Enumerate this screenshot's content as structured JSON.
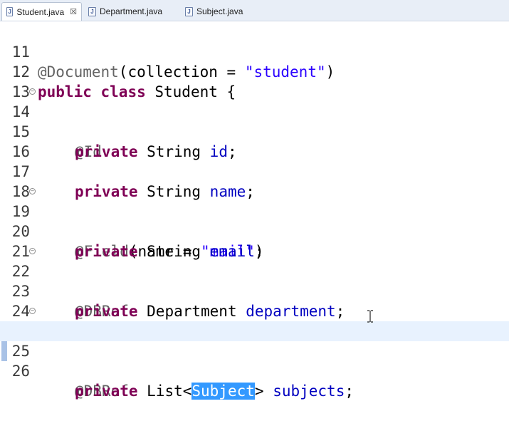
{
  "tabs": [
    {
      "label": "Student.java",
      "active": true,
      "close": "☒"
    },
    {
      "label": "Department.java",
      "active": false
    },
    {
      "label": "Subject.java",
      "active": false
    }
  ],
  "icons": {
    "java_file": "java-file-icon",
    "fold": "fold-collapse-icon",
    "cursor": "ibeam-cursor-icon"
  },
  "colors": {
    "keyword": "#7f0055",
    "string": "#2a00ff",
    "field": "#0000c0",
    "annotation": "#646464",
    "selection": "#3399ff"
  },
  "lines": [
    {
      "num": "11",
      "t": {
        "a": "@Document",
        "b": "(collection = ",
        "c": "\"student\"",
        "d": ")"
      }
    },
    {
      "num": "12",
      "t": {
        "k1": "public",
        "s1": " ",
        "k2": "class",
        "r": " Student {"
      }
    },
    {
      "num": "13"
    },
    {
      "num": "14",
      "t": {
        "a": "@Id"
      }
    },
    {
      "num": "15",
      "t": {
        "k": "private",
        "r": " String ",
        "f": "id",
        "e": ";"
      }
    },
    {
      "num": "16"
    },
    {
      "num": "17",
      "t": {
        "k": "private",
        "r": " String ",
        "f": "name",
        "e": ";"
      }
    },
    {
      "num": "18"
    },
    {
      "num": "19",
      "t": {
        "a": "@Field",
        "b": "(name = ",
        "c": "\"mail\"",
        "d": ")"
      }
    },
    {
      "num": "20",
      "t": {
        "k": "private",
        "r": " String ",
        "f": "email",
        "e": ";"
      }
    },
    {
      "num": "21"
    },
    {
      "num": "22",
      "t": {
        "a": "@DBRef"
      }
    },
    {
      "num": "23",
      "t": {
        "k": "private",
        "r": " Department ",
        "f": "department",
        "e": ";"
      }
    },
    {
      "num": "24"
    },
    {
      "num": "25",
      "t": {
        "a": "@DBRef"
      }
    },
    {
      "num": "26",
      "t": {
        "k": "private",
        "r": " List<",
        "sel": "Subject",
        "r2": "> ",
        "f": "subjects",
        "e": ";"
      }
    }
  ]
}
